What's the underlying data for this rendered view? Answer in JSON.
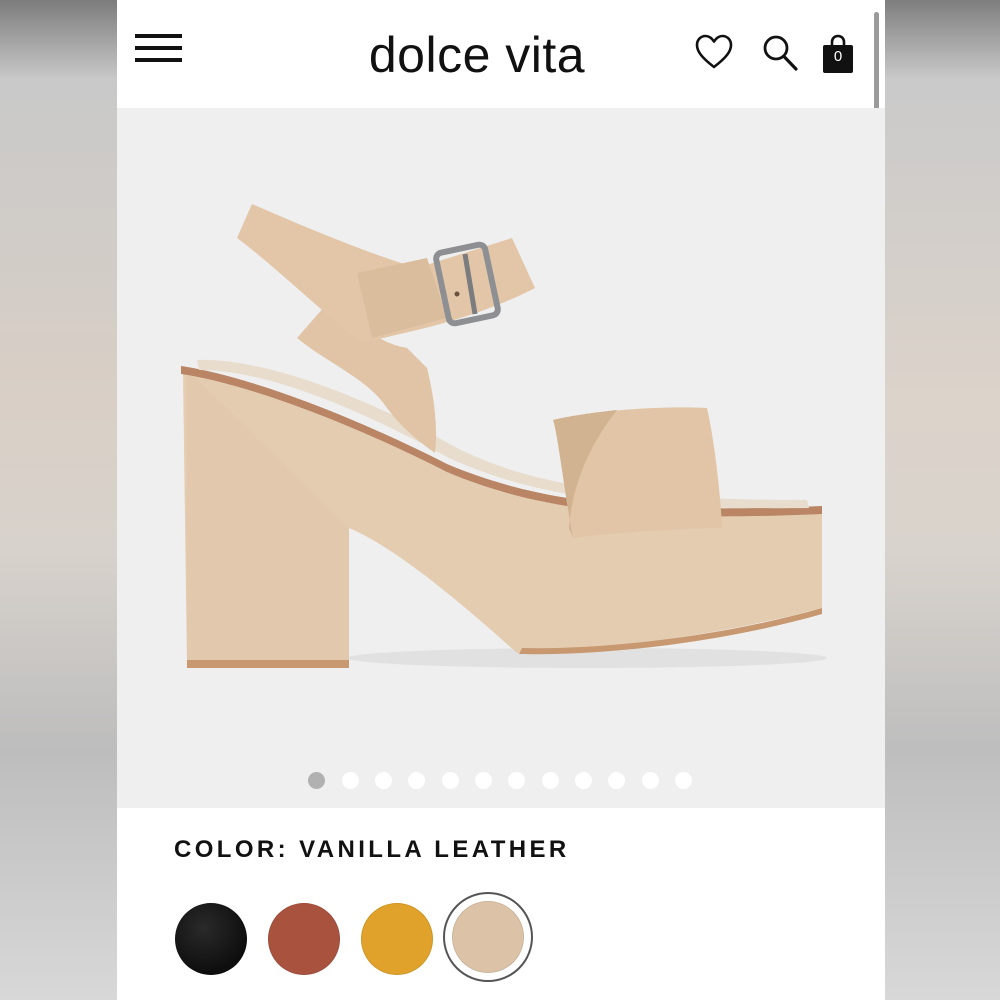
{
  "header": {
    "logo": "dolce vita",
    "bag_count": "0",
    "icons": [
      "menu-icon",
      "heart-icon",
      "search-icon",
      "bag-icon"
    ]
  },
  "gallery": {
    "image": "vanilla leather platform heel sandal",
    "dot_count": 12,
    "active_index": 0
  },
  "product": {
    "color_label": "COLOR: VANILLA LEATHER",
    "swatches": [
      {
        "name": "black",
        "color": "#141414"
      },
      {
        "name": "cognac",
        "color": "#a9533f"
      },
      {
        "name": "yellow",
        "color": "#e0a22a"
      },
      {
        "name": "vanilla",
        "color": "#dcc3a8",
        "selected": true
      }
    ]
  },
  "colors": {
    "text": "#111111",
    "gallery_bg": "#efefef",
    "sandal": "#e3c9ad",
    "dot_active": "#b1b1b1"
  }
}
